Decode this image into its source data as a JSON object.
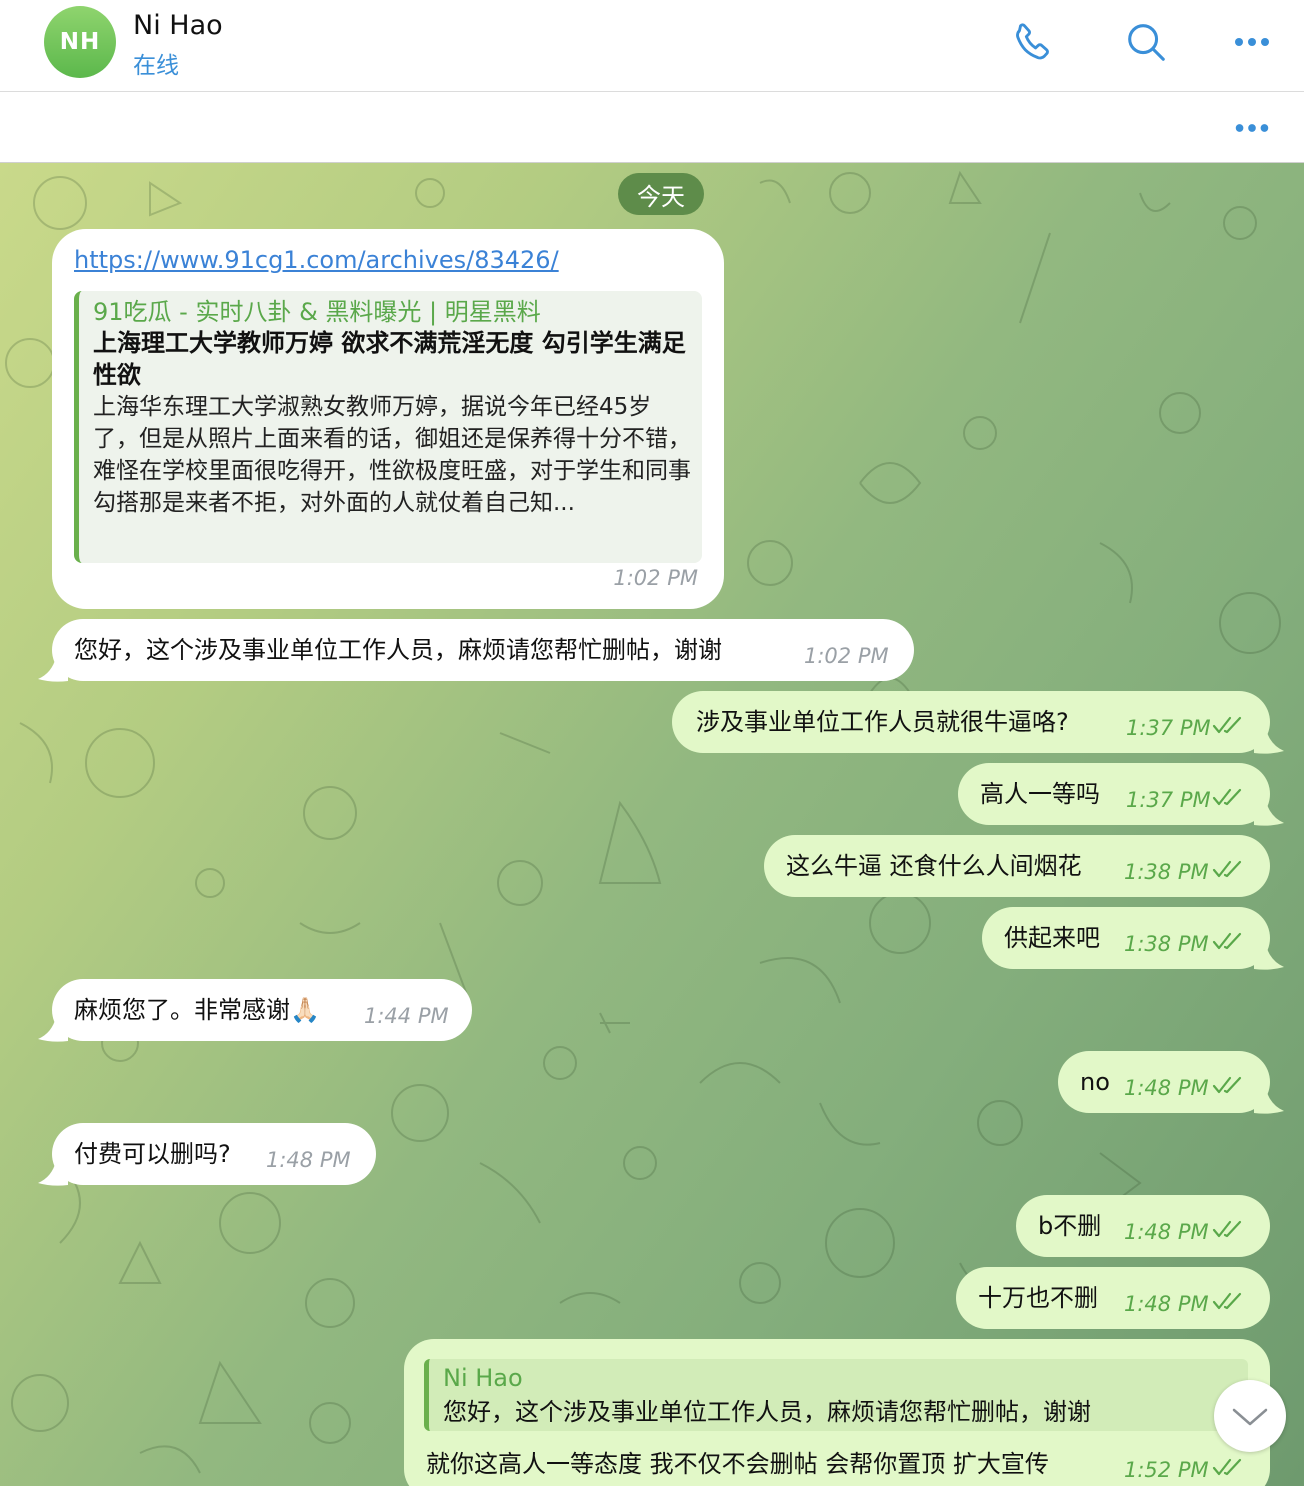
{
  "header": {
    "avatar_initials": "NH",
    "contact_name": "Ni Hao",
    "status": "在线",
    "icons": [
      "phone-icon",
      "search-icon",
      "more-icon"
    ]
  },
  "pinned": {
    "icon": "more-icon"
  },
  "chat": {
    "date_label": "今天",
    "link_message": {
      "url": "https://www.91cg1.com/archives/83426/",
      "preview_site": "91吃瓜 - 实时八卦 & 黑料曝光 | 明星黑料",
      "preview_title": "上海理工大学教师万婷 欲求不满荒淫无度 勾引学生满足性欲",
      "preview_description": "上海华东理工大学淑熟女教师万婷，据说今年已经45岁了，但是从照片上面来看的话，御姐还是保养得十分不错，难怪在学校里面很吃得开，性欲极度旺盛，对于学生和同事勾搭那是来者不拒，对外面的人就仗着自己知...",
      "time": "1:02 PM"
    },
    "messages": [
      {
        "direction": "in",
        "text": "您好，这个涉及事业单位工作人员，麻烦请您帮忙删帖，谢谢",
        "time": "1:02 PM"
      },
      {
        "direction": "out",
        "text": "涉及事业单位工作人员就很牛逼咯?",
        "time": "1:37 PM"
      },
      {
        "direction": "out",
        "text": "高人一等吗",
        "time": "1:37 PM"
      },
      {
        "direction": "out",
        "text": "这么牛逼 还食什么人间烟花",
        "time": "1:38 PM"
      },
      {
        "direction": "out",
        "text": "供起来吧",
        "time": "1:38 PM"
      },
      {
        "direction": "in",
        "text": "麻烦您了。非常感谢🙏🏻",
        "time": "1:44 PM"
      },
      {
        "direction": "out",
        "text": "no",
        "time": "1:48 PM"
      },
      {
        "direction": "in",
        "text": "付费可以删吗?",
        "time": "1:48 PM"
      },
      {
        "direction": "out",
        "text": "b不删",
        "time": "1:48 PM"
      },
      {
        "direction": "out",
        "text": "十万也不删",
        "time": "1:48 PM"
      }
    ],
    "reply_message": {
      "quoted_name": "Ni Hao",
      "quoted_text": "您好，这个涉及事业单位工作人员，麻烦请您帮忙删帖，谢谢",
      "text": "就你这高人一等态度 我不仅不会删帖 会帮你置顶 扩大宣传",
      "time": "1:52 PM"
    },
    "scroll_button_icon": "chevron-down-icon"
  },
  "colors": {
    "accent_blue": "#3a8fd8",
    "outgoing_bubble": "#e2f8c8",
    "incoming_bubble": "#ffffff",
    "read_ticks": "#5aa84a",
    "date_pill": "#5e8c4a"
  }
}
